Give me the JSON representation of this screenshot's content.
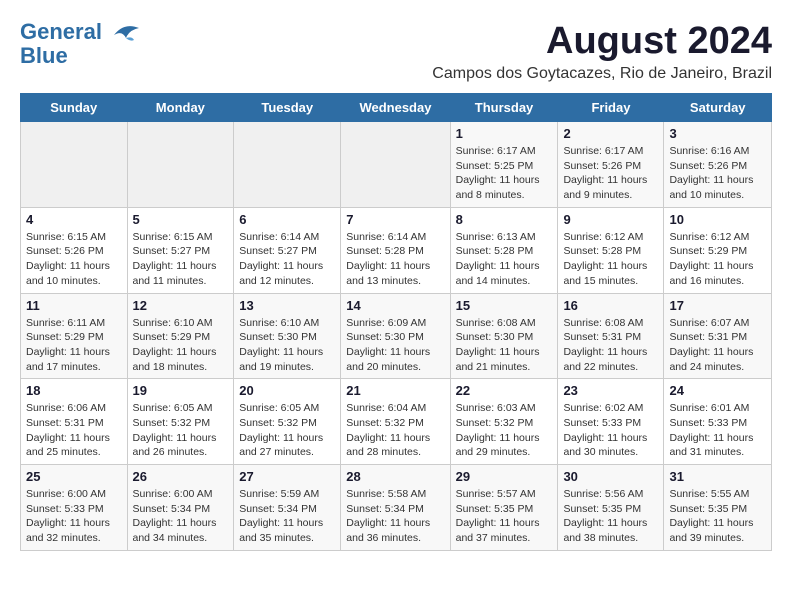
{
  "header": {
    "logo_line1": "General",
    "logo_line2": "Blue",
    "month_year": "August 2024",
    "location": "Campos dos Goytacazes, Rio de Janeiro, Brazil"
  },
  "days_of_week": [
    "Sunday",
    "Monday",
    "Tuesday",
    "Wednesday",
    "Thursday",
    "Friday",
    "Saturday"
  ],
  "weeks": [
    [
      {
        "num": "",
        "info": ""
      },
      {
        "num": "",
        "info": ""
      },
      {
        "num": "",
        "info": ""
      },
      {
        "num": "",
        "info": ""
      },
      {
        "num": "1",
        "info": "Sunrise: 6:17 AM\nSunset: 5:25 PM\nDaylight: 11 hours and 8 minutes."
      },
      {
        "num": "2",
        "info": "Sunrise: 6:17 AM\nSunset: 5:26 PM\nDaylight: 11 hours and 9 minutes."
      },
      {
        "num": "3",
        "info": "Sunrise: 6:16 AM\nSunset: 5:26 PM\nDaylight: 11 hours and 10 minutes."
      }
    ],
    [
      {
        "num": "4",
        "info": "Sunrise: 6:15 AM\nSunset: 5:26 PM\nDaylight: 11 hours and 10 minutes."
      },
      {
        "num": "5",
        "info": "Sunrise: 6:15 AM\nSunset: 5:27 PM\nDaylight: 11 hours and 11 minutes."
      },
      {
        "num": "6",
        "info": "Sunrise: 6:14 AM\nSunset: 5:27 PM\nDaylight: 11 hours and 12 minutes."
      },
      {
        "num": "7",
        "info": "Sunrise: 6:14 AM\nSunset: 5:28 PM\nDaylight: 11 hours and 13 minutes."
      },
      {
        "num": "8",
        "info": "Sunrise: 6:13 AM\nSunset: 5:28 PM\nDaylight: 11 hours and 14 minutes."
      },
      {
        "num": "9",
        "info": "Sunrise: 6:12 AM\nSunset: 5:28 PM\nDaylight: 11 hours and 15 minutes."
      },
      {
        "num": "10",
        "info": "Sunrise: 6:12 AM\nSunset: 5:29 PM\nDaylight: 11 hours and 16 minutes."
      }
    ],
    [
      {
        "num": "11",
        "info": "Sunrise: 6:11 AM\nSunset: 5:29 PM\nDaylight: 11 hours and 17 minutes."
      },
      {
        "num": "12",
        "info": "Sunrise: 6:10 AM\nSunset: 5:29 PM\nDaylight: 11 hours and 18 minutes."
      },
      {
        "num": "13",
        "info": "Sunrise: 6:10 AM\nSunset: 5:30 PM\nDaylight: 11 hours and 19 minutes."
      },
      {
        "num": "14",
        "info": "Sunrise: 6:09 AM\nSunset: 5:30 PM\nDaylight: 11 hours and 20 minutes."
      },
      {
        "num": "15",
        "info": "Sunrise: 6:08 AM\nSunset: 5:30 PM\nDaylight: 11 hours and 21 minutes."
      },
      {
        "num": "16",
        "info": "Sunrise: 6:08 AM\nSunset: 5:31 PM\nDaylight: 11 hours and 22 minutes."
      },
      {
        "num": "17",
        "info": "Sunrise: 6:07 AM\nSunset: 5:31 PM\nDaylight: 11 hours and 24 minutes."
      }
    ],
    [
      {
        "num": "18",
        "info": "Sunrise: 6:06 AM\nSunset: 5:31 PM\nDaylight: 11 hours and 25 minutes."
      },
      {
        "num": "19",
        "info": "Sunrise: 6:05 AM\nSunset: 5:32 PM\nDaylight: 11 hours and 26 minutes."
      },
      {
        "num": "20",
        "info": "Sunrise: 6:05 AM\nSunset: 5:32 PM\nDaylight: 11 hours and 27 minutes."
      },
      {
        "num": "21",
        "info": "Sunrise: 6:04 AM\nSunset: 5:32 PM\nDaylight: 11 hours and 28 minutes."
      },
      {
        "num": "22",
        "info": "Sunrise: 6:03 AM\nSunset: 5:32 PM\nDaylight: 11 hours and 29 minutes."
      },
      {
        "num": "23",
        "info": "Sunrise: 6:02 AM\nSunset: 5:33 PM\nDaylight: 11 hours and 30 minutes."
      },
      {
        "num": "24",
        "info": "Sunrise: 6:01 AM\nSunset: 5:33 PM\nDaylight: 11 hours and 31 minutes."
      }
    ],
    [
      {
        "num": "25",
        "info": "Sunrise: 6:00 AM\nSunset: 5:33 PM\nDaylight: 11 hours and 32 minutes."
      },
      {
        "num": "26",
        "info": "Sunrise: 6:00 AM\nSunset: 5:34 PM\nDaylight: 11 hours and 34 minutes."
      },
      {
        "num": "27",
        "info": "Sunrise: 5:59 AM\nSunset: 5:34 PM\nDaylight: 11 hours and 35 minutes."
      },
      {
        "num": "28",
        "info": "Sunrise: 5:58 AM\nSunset: 5:34 PM\nDaylight: 11 hours and 36 minutes."
      },
      {
        "num": "29",
        "info": "Sunrise: 5:57 AM\nSunset: 5:35 PM\nDaylight: 11 hours and 37 minutes."
      },
      {
        "num": "30",
        "info": "Sunrise: 5:56 AM\nSunset: 5:35 PM\nDaylight: 11 hours and 38 minutes."
      },
      {
        "num": "31",
        "info": "Sunrise: 5:55 AM\nSunset: 5:35 PM\nDaylight: 11 hours and 39 minutes."
      }
    ]
  ]
}
